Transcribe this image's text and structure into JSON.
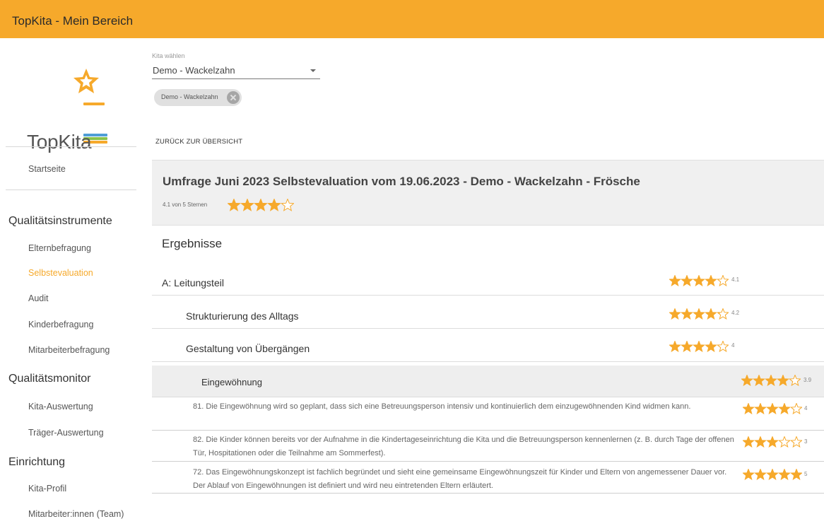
{
  "app": {
    "title": "TopKita - Mein Bereich"
  },
  "logo": {
    "word": "TopKita",
    "star_color": "#f6a92b"
  },
  "sidebar": {
    "home": "Startseite",
    "sections": [
      {
        "title": "Qualitätsinstrumente",
        "items": [
          "Elternbefragung",
          "Selbstevaluation",
          "Audit",
          "Kinderbefragung",
          "Mitarbeiterbefragung"
        ],
        "active": "Selbstevaluation"
      },
      {
        "title": "Qualitätsmonitor",
        "items": [
          "Kita-Auswertung",
          "Träger-Auswertung"
        ]
      },
      {
        "title": "Einrichtung",
        "items": [
          "Kita-Profil",
          "Mitarbeiter:innen (Team)"
        ]
      }
    ]
  },
  "filter": {
    "label": "Kita wählen",
    "selected": "Demo - Wackelzahn",
    "chip": "Demo - Wackelzahn"
  },
  "back_link": "ZURÜCK ZUR ÜBERSICHT",
  "survey": {
    "title": "Umfrage Juni 2023 Selbstevaluation vom 19.06.2023 - Demo - Wackelzahn - Frösche",
    "rating_text": "4.1 von 5 Sternen",
    "rating": 4.1
  },
  "results": {
    "title": "Ergebnisse",
    "rows": [
      {
        "label": "A: Leitungsteil",
        "rating": 4.1,
        "score": "4.1"
      },
      {
        "label": "Strukturierung des Alltags",
        "rating": 4.2,
        "score": "4.2"
      },
      {
        "label": "Gestaltung von Übergängen",
        "rating": 4,
        "score": "4"
      },
      {
        "label": "Eingewöhnung",
        "rating": 3.9,
        "score": "3.9"
      }
    ],
    "questions": [
      {
        "text": "81. Die Eingewöhnung wird so geplant, dass sich eine Betreuungsperson intensiv und kontinuierlich dem einzugewöhnenden Kind widmen kann.",
        "rating": 4,
        "score": "4"
      },
      {
        "text": "82. Die Kinder können bereits vor der Aufnahme in die Kindertageseinrichtung die Kita und die Betreuungsperson kennenlernen (z. B. durch Tage der offenen Tür, Hospitationen oder die Teilnahme am Sommerfest).",
        "rating": 3,
        "score": "3"
      },
      {
        "text": "72. Das Eingewöhnungskonzept ist fachlich begründet und sieht eine gemeinsame Eingewöhnungszeit für Kinder und Eltern von angemessener Dauer vor. Der Ablauf von Eingewöhnungen ist definiert und wird neu eintretenden Eltern erläutert.",
        "rating": 5,
        "score": "5"
      }
    ]
  },
  "colors": {
    "accent": "#f6a92b",
    "star": "#f6a92b",
    "highlight_row": "#eeeeee"
  }
}
